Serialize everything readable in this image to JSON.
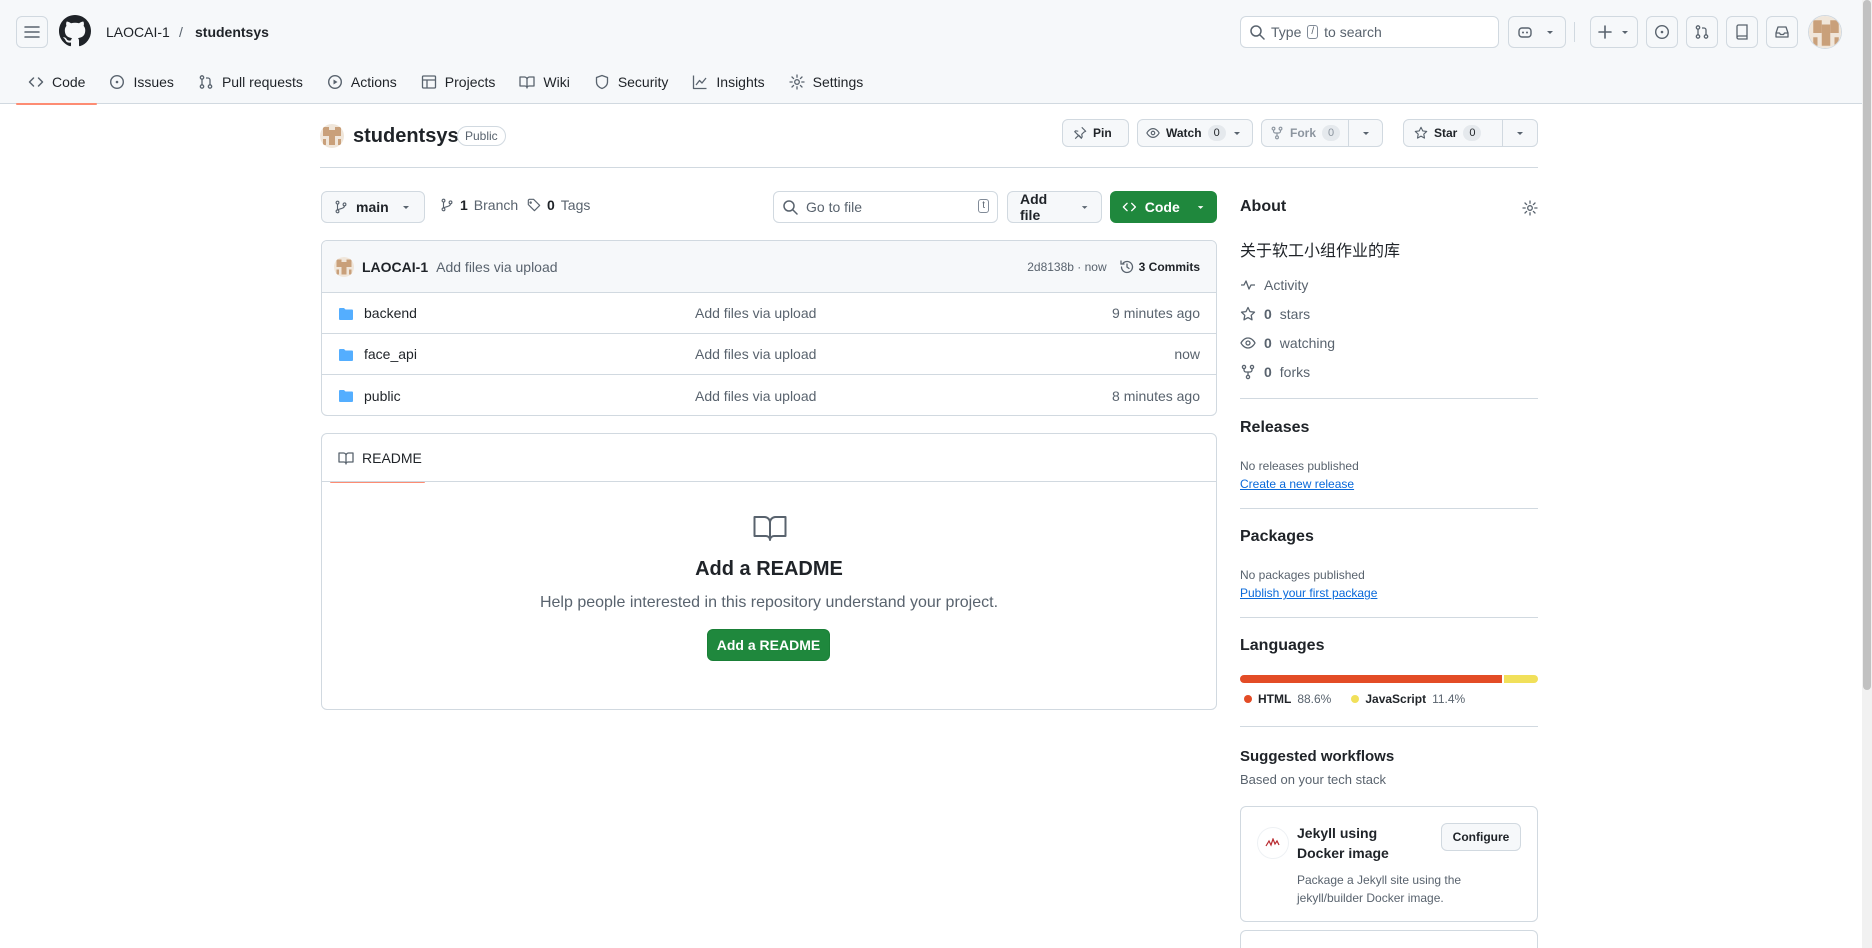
{
  "header": {
    "owner": "LAOCAI-1",
    "separator": "/",
    "repo": "studentsys",
    "search_prefix": "Type",
    "search_key": "/",
    "search_suffix": "to search"
  },
  "tabs": [
    {
      "label": "Code",
      "icon": "code-icon",
      "selected": true
    },
    {
      "label": "Issues",
      "icon": "issue-icon"
    },
    {
      "label": "Pull requests",
      "icon": "pull-request-icon"
    },
    {
      "label": "Actions",
      "icon": "play-icon"
    },
    {
      "label": "Projects",
      "icon": "table-icon"
    },
    {
      "label": "Wiki",
      "icon": "book-icon"
    },
    {
      "label": "Security",
      "icon": "shield-icon"
    },
    {
      "label": "Insights",
      "icon": "graph-icon"
    },
    {
      "label": "Settings",
      "icon": "gear-icon"
    }
  ],
  "repo": {
    "name": "studentsys",
    "visibility": "Public",
    "pin_label": "Pin",
    "watch_label": "Watch",
    "watch_count": "0",
    "fork_label": "Fork",
    "fork_count": "0",
    "star_label": "Star",
    "star_count": "0"
  },
  "toolbar": {
    "branch": "main",
    "branch_count": "1",
    "branch_label": "Branch",
    "tag_count": "0",
    "tag_label": "Tags",
    "goto_placeholder": "Go to file",
    "goto_key": "t",
    "add_file": "Add file",
    "code": "Code"
  },
  "commit": {
    "author": "LAOCAI-1",
    "message": "Add files via upload",
    "hash_time": "2d8138b · now",
    "commits_label": "3 Commits"
  },
  "files": [
    {
      "name": "backend",
      "message": "Add files via upload",
      "age": "9 minutes ago"
    },
    {
      "name": "face_api",
      "message": "Add files via upload",
      "age": "now"
    },
    {
      "name": "public",
      "message": "Add files via upload",
      "age": "8 minutes ago"
    }
  ],
  "readme": {
    "tab": "README",
    "title": "Add a README",
    "subtitle": "Help people interested in this repository understand your project.",
    "button": "Add a README"
  },
  "about": {
    "heading": "About",
    "description": "关于软工小组作业的库",
    "activity": "Activity",
    "stars_count": "0",
    "stars_label": "stars",
    "watching_count": "0",
    "watching_label": "watching",
    "forks_count": "0",
    "forks_label": "forks"
  },
  "releases": {
    "heading": "Releases",
    "none": "No releases published",
    "link": "Create a new release"
  },
  "packages": {
    "heading": "Packages",
    "none": "No packages published",
    "link": "Publish your first package"
  },
  "languages": {
    "heading": "Languages",
    "items": [
      {
        "name": "HTML",
        "percent": "88.6%",
        "value": 88.6,
        "color": "#e34c26"
      },
      {
        "name": "JavaScript",
        "percent": "11.4%",
        "value": 11.4,
        "color": "#f1e05a"
      }
    ]
  },
  "workflows": {
    "heading": "Suggested workflows",
    "subheading": "Based on your tech stack",
    "card_title": "Jekyll using Docker image",
    "card_desc": "Package a Jekyll site using the jekyll/builder Docker image.",
    "card_button": "Configure"
  },
  "colors": {
    "accent_green": "#1f883d",
    "tab_underline": "#fd8c73",
    "link_blue": "#0969da",
    "folder_blue": "#54aeff"
  }
}
